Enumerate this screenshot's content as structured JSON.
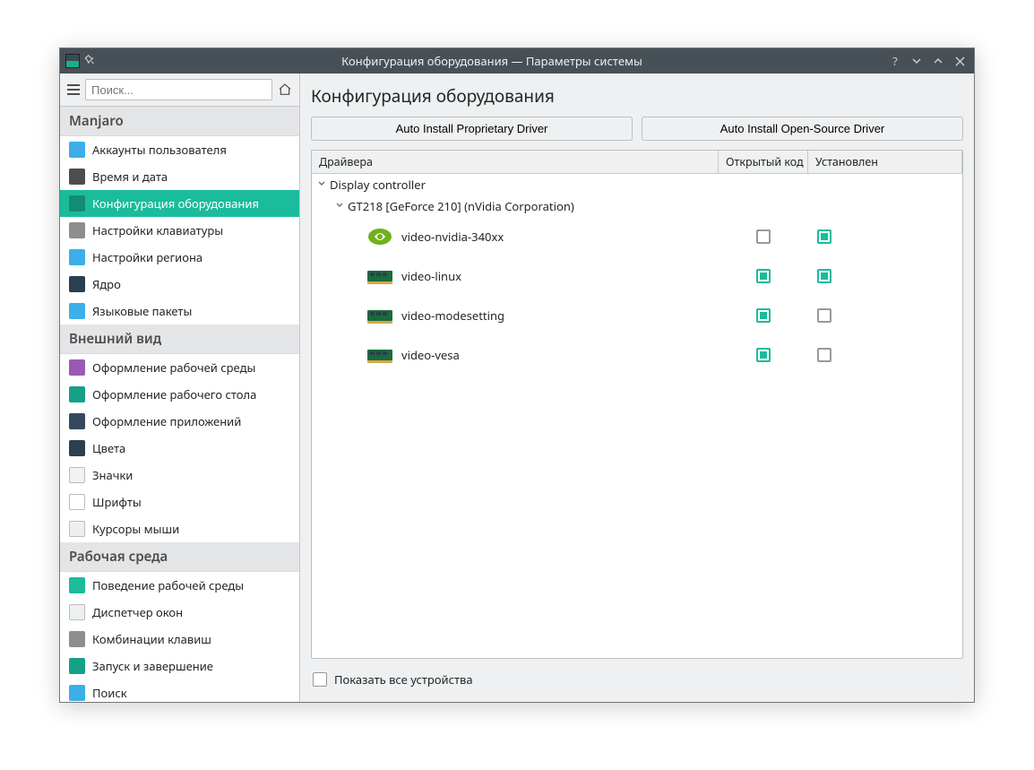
{
  "titlebar": {
    "title": "Конфигурация оборудования — Параметры системы"
  },
  "search": {
    "placeholder": "Поиск..."
  },
  "sidebar": {
    "categories": [
      {
        "label": "Manjaro",
        "items": [
          {
            "label": "Аккаунты пользователя",
            "selected": false,
            "iconColor": "#3daee9"
          },
          {
            "label": "Время и дата",
            "selected": false,
            "iconColor": "#4d4d4d"
          },
          {
            "label": "Конфигурация оборудования",
            "selected": true,
            "iconColor": "#148b73"
          },
          {
            "label": "Настройки клавиатуры",
            "selected": false,
            "iconColor": "#8e8e8e"
          },
          {
            "label": "Настройки региона",
            "selected": false,
            "iconColor": "#3daee9"
          },
          {
            "label": "Ядро",
            "selected": false,
            "iconColor": "#2c3e50"
          },
          {
            "label": "Языковые пакеты",
            "selected": false,
            "iconColor": "#3daee9"
          }
        ]
      },
      {
        "label": "Внешний вид",
        "items": [
          {
            "label": "Оформление рабочей среды",
            "iconColor": "#9b59b6"
          },
          {
            "label": "Оформление рабочего стола",
            "iconColor": "#16a085"
          },
          {
            "label": "Оформление приложений",
            "iconColor": "#34495e"
          },
          {
            "label": "Цвета",
            "iconColor": "#2c3e50"
          },
          {
            "label": "Значки",
            "iconColor": "#f2f2f2"
          },
          {
            "label": "Шрифты",
            "iconColor": "#ffffff"
          },
          {
            "label": "Курсоры мыши",
            "iconColor": "#ecf0f1"
          }
        ]
      },
      {
        "label": "Рабочая среда",
        "items": [
          {
            "label": "Поведение рабочей среды",
            "iconColor": "#1abc9c"
          },
          {
            "label": "Диспетчер окон",
            "iconColor": "#ecf0f1"
          },
          {
            "label": "Комбинации клавиш",
            "iconColor": "#8e8e8e"
          },
          {
            "label": "Запуск и завершение",
            "iconColor": "#16a085"
          },
          {
            "label": "Поиск",
            "iconColor": "#3daee9"
          }
        ]
      }
    ]
  },
  "page": {
    "title": "Конфигурация оборудования",
    "btn_proprietary": "Auto Install Proprietary Driver",
    "btn_opensource": "Auto Install Open-Source Driver",
    "columns": {
      "driver": "Драйвера",
      "open": "Открытый код",
      "installed": "Установлен"
    },
    "tree": {
      "root": "Display controller",
      "device": "GT218 [GeForce 210] (nVidia Corporation)",
      "drivers": [
        {
          "name": "video-nvidia-340xx",
          "open": false,
          "installed": true,
          "iconType": "nvidia"
        },
        {
          "name": "video-linux",
          "open": true,
          "installed": true,
          "iconType": "chip"
        },
        {
          "name": "video-modesetting",
          "open": true,
          "installed": false,
          "iconType": "chip"
        },
        {
          "name": "video-vesa",
          "open": true,
          "installed": false,
          "iconType": "chip"
        }
      ]
    },
    "show_all": "Показать все устройства"
  }
}
